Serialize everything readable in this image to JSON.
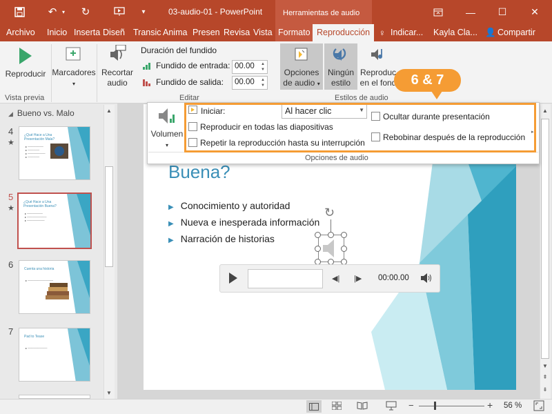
{
  "app": {
    "doc_title": "03-audio-01 - PowerPoint",
    "context_header": "Herramientas de audio"
  },
  "tabs": [
    "Archivo",
    "Inicio",
    "Inserta",
    "Diseñ",
    "Transic",
    "Anima",
    "Presen",
    "Revisa",
    "Vista",
    "Formato",
    "Reproducción"
  ],
  "tabs_right": {
    "tell_me": "Indicar...",
    "user": "Kayla Cla...",
    "share": "Compartir"
  },
  "ribbon": {
    "play": "Reproducir",
    "markers": "Marcadores",
    "trim_line1": "Recortar",
    "trim_line2": "audio",
    "fade_title": "Duración del fundido",
    "fade_in_label": "Fundido de entrada:",
    "fade_in_value": "00.00",
    "fade_out_label": "Fundido de salida:",
    "fade_out_value": "00.00",
    "audio_options_line1": "Opciones",
    "audio_options_line2": "de audio",
    "no_style_line1": "Ningún",
    "no_style_line2": "estilo",
    "play_bg_line1": "Reproduc",
    "play_bg_line2": "en el fond",
    "group_preview": "Vista previa",
    "group_edit": "Editar",
    "group_audio_styles": "Estilos de audio"
  },
  "popup": {
    "volume": "Volumen",
    "start_label": "Iniciar:",
    "start_value": "Al hacer clic",
    "play_across": "Reproducir en todas las diapositivas",
    "loop": "Repetir la reproducción hasta su interrupción",
    "hide": "Ocultar durante presentación",
    "rewind": "Rebobinar después de la reproducción",
    "group_label": "Opciones de audio"
  },
  "callout": "6 & 7",
  "pane": {
    "section": "Bueno vs. Malo",
    "thumbs": [
      {
        "num": "4",
        "title": "¿Qué Hace a Una Presentación Mala?"
      },
      {
        "num": "5",
        "title": "¿Qué Hace a Una Presentación Buena?"
      },
      {
        "num": "6",
        "title": "Cuenta una historia"
      },
      {
        "num": "7",
        "title": "Pad to Tease"
      }
    ]
  },
  "slide": {
    "title": "Buena?",
    "bullets": [
      "Conocimiento y autoridad",
      "Nueva e inesperada información",
      "Narración de historias"
    ],
    "player_time": "00:00.00"
  },
  "status": {
    "zoom": "56 %"
  },
  "colors": {
    "accent": "#b7472a",
    "callout": "#f59c34",
    "slide_blue": "#3a8fb7"
  }
}
